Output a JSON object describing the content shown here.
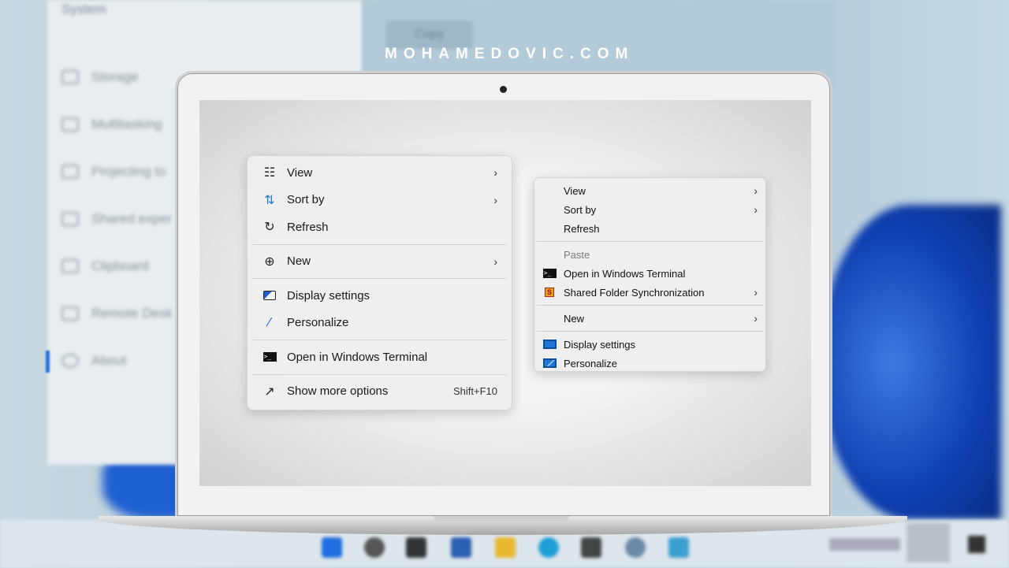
{
  "watermark": "MOHAMEDOVIC.COM",
  "background_settings": {
    "title": "System",
    "copy_button": "Copy",
    "items": [
      "Storage",
      "Multitasking",
      "Projecting to",
      "Shared exper",
      "Clipboard",
      "Remote Desk",
      "About"
    ]
  },
  "win11_menu": {
    "items": [
      {
        "label": "View",
        "icon": "grid-icon",
        "submenu": true
      },
      {
        "label": "Sort by",
        "icon": "sort-icon",
        "submenu": true
      },
      {
        "label": "Refresh",
        "icon": "refresh-icon"
      },
      {
        "label": "New",
        "icon": "plus-circle-icon",
        "submenu": true
      },
      {
        "label": "Display settings",
        "icon": "display-settings-icon"
      },
      {
        "label": "Personalize",
        "icon": "brush-icon"
      },
      {
        "label": "Open in Windows Terminal",
        "icon": "terminal-icon"
      },
      {
        "label": "Show more options",
        "icon": "external-icon",
        "shortcut": "Shift+F10"
      }
    ]
  },
  "classic_menu": {
    "items": [
      {
        "label": "View",
        "submenu": true
      },
      {
        "label": "Sort by",
        "submenu": true
      },
      {
        "label": "Refresh"
      },
      {
        "label": "Paste",
        "disabled": true
      },
      {
        "label": "Open in Windows Terminal",
        "icon": "terminal-icon"
      },
      {
        "label": "Shared Folder Synchronization",
        "icon": "sync-icon",
        "submenu": true
      },
      {
        "label": "New",
        "submenu": true
      },
      {
        "label": "Display settings",
        "icon": "monitor-icon"
      },
      {
        "label": "Personalize",
        "icon": "personalize-icon"
      }
    ]
  }
}
